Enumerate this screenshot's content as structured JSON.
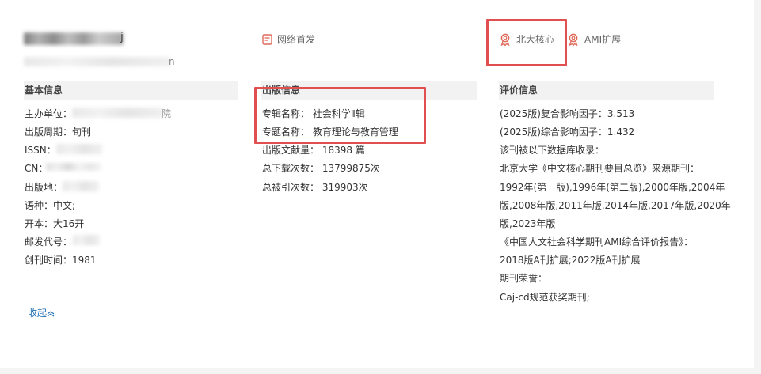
{
  "header": {
    "title_tail": "j",
    "subtitle_tail": "n"
  },
  "badges": [
    {
      "label": "网络首发",
      "icon": "document-icon"
    },
    {
      "label": "北大核心",
      "icon": "award-icon"
    },
    {
      "label": "AMI扩展",
      "icon": "award-icon"
    }
  ],
  "basic": {
    "heading": "基本信息",
    "sponsor_label": "主办单位：",
    "sponsor_tail": "院",
    "period_label": "出版周期：",
    "period_value": "旬刊",
    "issn_label": "ISSN：",
    "cn_label": "CN：",
    "place_label": "出版地：",
    "language_label": "语种：",
    "language_value": "中文;",
    "format_label": "开本：",
    "format_value": "大16开",
    "postal_label": "邮发代号：",
    "founded_label": "创刊时间：",
    "founded_value": "1981"
  },
  "publication": {
    "heading": "出版信息",
    "series_label": "专辑名称：",
    "series_value": "社会科学Ⅱ辑",
    "topic_label": "专题名称：",
    "topic_value": "教育理论与教育管理",
    "articles_label": "出版文献量：",
    "articles_value": "18398 篇",
    "downloads_label": "总下载次数：",
    "downloads_value": "13799875次",
    "citations_label": "总被引次数：",
    "citations_value": "319903次"
  },
  "evaluation": {
    "heading": "评价信息",
    "lines": [
      "(2025版)复合影响因子：3.513",
      "(2025版)综合影响因子：1.432",
      "该刊被以下数据库收录：",
      "北京大学《中文核心期刊要目总览》来源期刊：",
      "1992年(第一版),1996年(第二版),2000年版,2004年",
      "版,2008年版,2011年版,2014年版,2017年版,2020年",
      "版,2023年版",
      "《中国人文社会科学期刊AMI综合评价报告》：",
      "2018版A刊扩展;2022版A刊扩展",
      "期刊荣誉：",
      "Caj-cd规范获奖期刊;"
    ]
  },
  "collapse_label": "收起",
  "colors": {
    "highlight": "#e05050",
    "link": "#1e6fb5",
    "icon": "#e06a5a"
  }
}
